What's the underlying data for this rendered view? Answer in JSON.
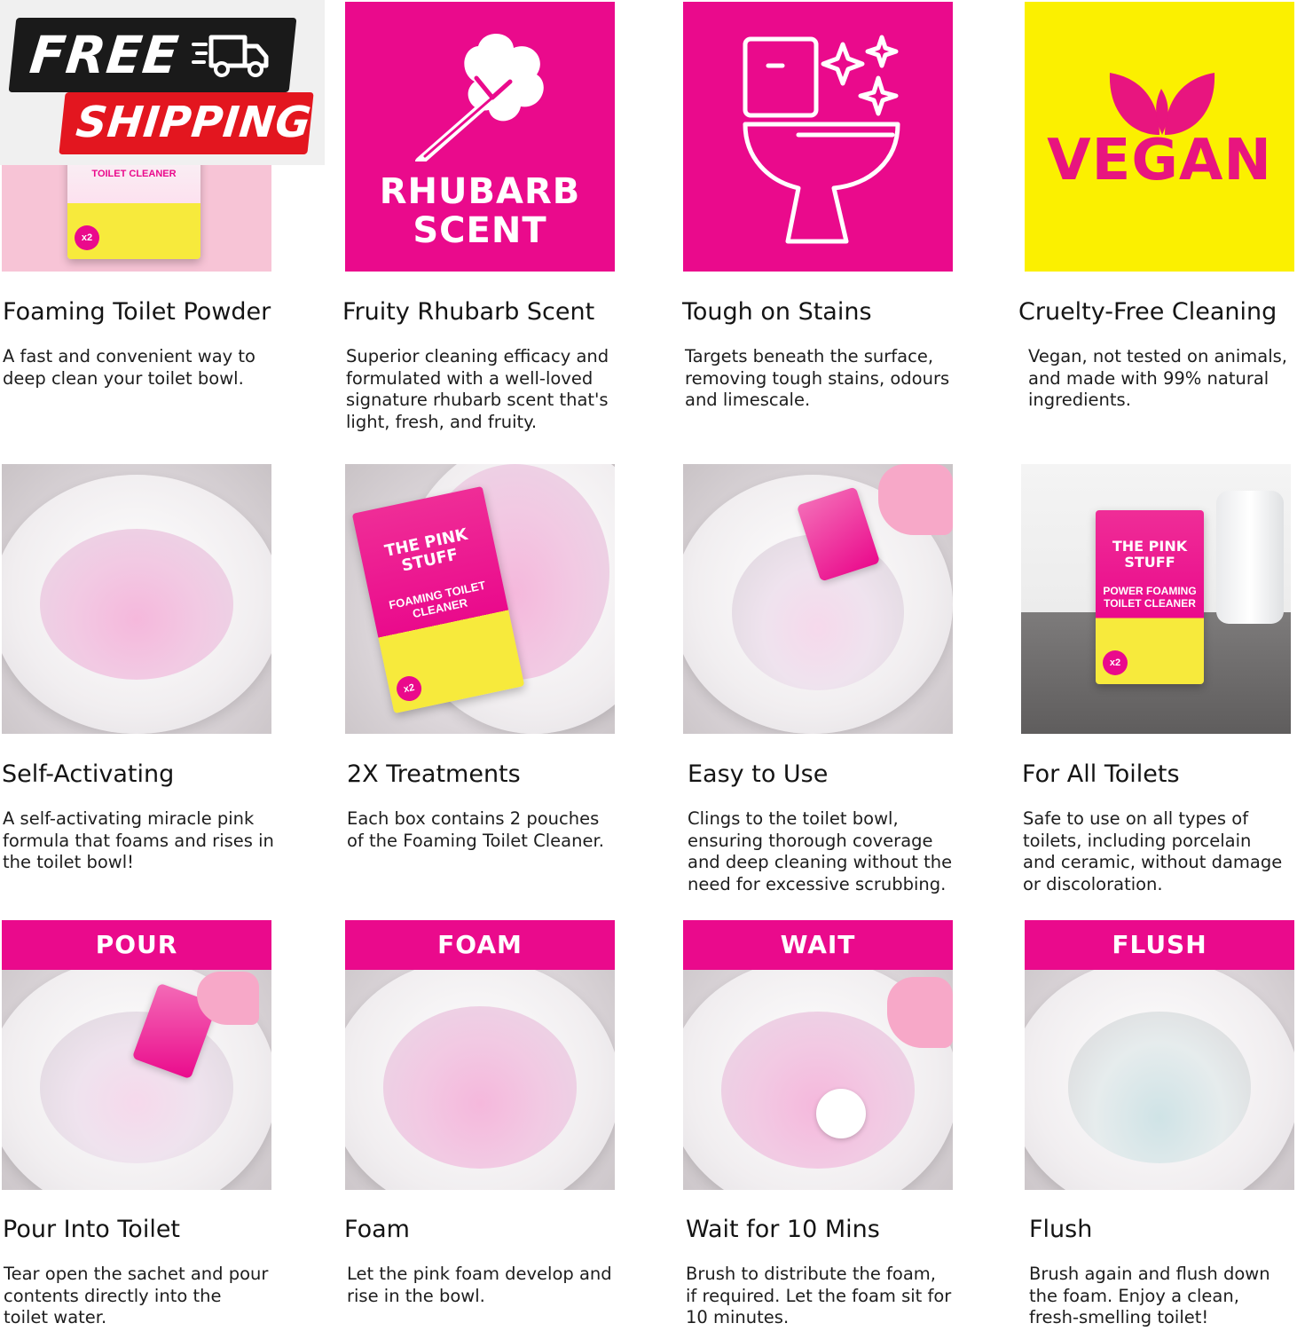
{
  "badge": {
    "line1": "FREE",
    "line2": "SHIPPING"
  },
  "row1": [
    {
      "title": "Foaming Toilet Powder",
      "desc": "A fast and convenient way to deep clean your toilet bowl.",
      "box_brand": "",
      "box_product": "TOILET CLEANER",
      "box_count": "x2"
    },
    {
      "title": "Fruity Rhubarb Scent",
      "desc": "Superior cleaning efficacy and formulated with a well-loved signature rhubarb scent that's light, fresh, and fruity.",
      "icon_text": "RHUBARB SCENT",
      "icon": "rhubarb-icon"
    },
    {
      "title": "Tough on Stains",
      "desc": "Targets beneath the surface, removing tough stains, odours and limescale.",
      "icon": "toilet-sparkle-icon"
    },
    {
      "title": "Cruelty-Free Cleaning",
      "desc": "Vegan, not tested on animals, and made with 99% natural ingredients.",
      "icon_text": "VEGAN",
      "icon": "leaves-icon"
    }
  ],
  "row2": [
    {
      "title": "Self-Activating",
      "desc": "A self-activating miracle pink formula that foams and rises in the toilet bowl!"
    },
    {
      "title": "2X Treatments",
      "desc": "Each box contains 2 pouches of the Foaming Toilet Cleaner.",
      "box_brand": "THE PINK STUFF",
      "box_product": "FOAMING TOILET CLEANER",
      "box_count": "x2"
    },
    {
      "title": "Easy to Use",
      "desc": "Clings to the toilet bowl, ensuring thorough coverage and deep cleaning without the need for excessive scrubbing."
    },
    {
      "title": "For All Toilets",
      "desc": "Safe to use on all types of toilets, including porcelain and ceramic, without damage or discoloration.",
      "box_brand": "THE PINK STUFF",
      "box_product": "POWER FOAMING TOILET CLEANER",
      "box_count": "x2"
    }
  ],
  "row3": [
    {
      "label": "POUR",
      "title": "Pour Into Toilet",
      "desc": "Tear open the sachet and pour contents directly into the toilet water."
    },
    {
      "label": "FOAM",
      "title": "Foam",
      "desc": "Let the pink foam develop and rise in the bowl."
    },
    {
      "label": "WAIT",
      "title": "Wait for 10 Mins",
      "desc": "Brush to distribute the foam, if required. Let the foam sit for 10 minutes."
    },
    {
      "label": "FLUSH",
      "title": "Flush",
      "desc": "Brush again and flush down the foam. Enjoy a clean, fresh-smelling toilet!"
    }
  ],
  "colors": {
    "brand_pink": "#ea0a8c",
    "vegan_yellow": "#fbf000",
    "shipping_red": "#e3161f"
  }
}
